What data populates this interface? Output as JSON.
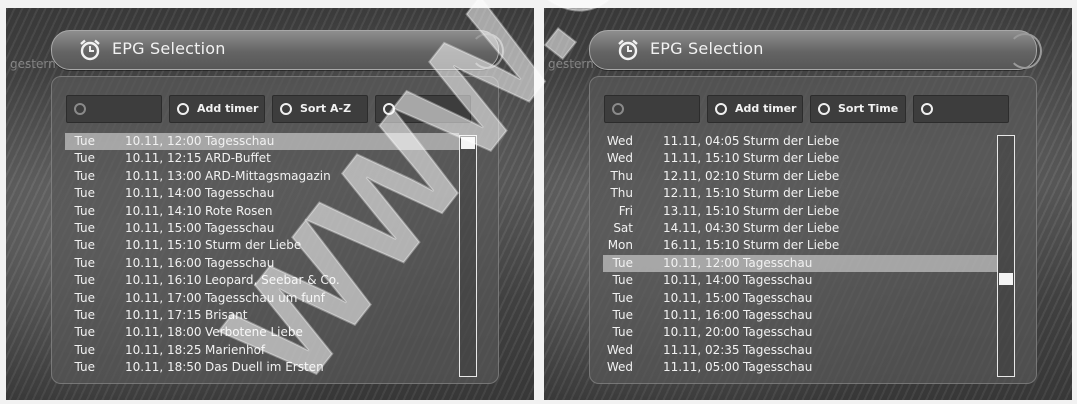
{
  "left": {
    "title": "EPG Selection",
    "ghost_text": "gestern",
    "buttons": [
      {
        "label": "",
        "state": "dim"
      },
      {
        "label": "Add timer",
        "state": "active"
      },
      {
        "label": "Sort A-Z",
        "state": "active"
      },
      {
        "label": "",
        "state": "active"
      }
    ],
    "rows": [
      {
        "day": "Tue",
        "datetime": "10.11, 12:00",
        "title": "Tagesschau"
      },
      {
        "day": "Tue",
        "datetime": "10.11, 12:15",
        "title": "ARD-Buffet"
      },
      {
        "day": "Tue",
        "datetime": "10.11, 13:00",
        "title": "ARD-Mittagsmagazin"
      },
      {
        "day": "Tue",
        "datetime": "10.11, 14:00",
        "title": "Tagesschau"
      },
      {
        "day": "Tue",
        "datetime": "10.11, 14:10",
        "title": "Rote Rosen"
      },
      {
        "day": "Tue",
        "datetime": "10.11, 15:00",
        "title": "Tagesschau"
      },
      {
        "day": "Tue",
        "datetime": "10.11, 15:10",
        "title": "Sturm der Liebe"
      },
      {
        "day": "Tue",
        "datetime": "10.11, 16:00",
        "title": "Tagesschau"
      },
      {
        "day": "Tue",
        "datetime": "10.11, 16:10",
        "title": "Leopard, Seebar & Co."
      },
      {
        "day": "Tue",
        "datetime": "10.11, 17:00",
        "title": "Tagesschau um funf"
      },
      {
        "day": "Tue",
        "datetime": "10.11, 17:15",
        "title": "Brisant"
      },
      {
        "day": "Tue",
        "datetime": "10.11, 18:00",
        "title": "Verbotene Liebe"
      },
      {
        "day": "Tue",
        "datetime": "10.11, 18:25",
        "title": "Marienhof"
      },
      {
        "day": "Tue",
        "datetime": "10.11, 18:50",
        "title": "Das Duell im Ersten"
      }
    ],
    "selected_index": 0,
    "scroll_position": 0.0
  },
  "right": {
    "title": "EPG Selection",
    "ghost_text": "gestern",
    "buttons": [
      {
        "label": "",
        "state": "dim"
      },
      {
        "label": "Add timer",
        "state": "active"
      },
      {
        "label": "Sort Time",
        "state": "active"
      },
      {
        "label": "",
        "state": "active"
      }
    ],
    "rows": [
      {
        "day": "Wed",
        "datetime": "11.11, 04:05",
        "title": "Sturm der Liebe"
      },
      {
        "day": "Wed",
        "datetime": "11.11, 15:10",
        "title": "Sturm der Liebe"
      },
      {
        "day": "Thu",
        "datetime": "12.11, 02:10",
        "title": "Sturm der Liebe"
      },
      {
        "day": "Thu",
        "datetime": "12.11, 15:10",
        "title": "Sturm der Liebe"
      },
      {
        "day": "Fri",
        "datetime": "13.11, 15:10",
        "title": "Sturm der Liebe"
      },
      {
        "day": "Sat",
        "datetime": "14.11, 04:30",
        "title": "Sturm der Liebe"
      },
      {
        "day": "Mon",
        "datetime": "16.11, 15:10",
        "title": "Sturm der Liebe"
      },
      {
        "day": "Tue",
        "datetime": "10.11, 12:00",
        "title": "Tagesschau"
      },
      {
        "day": "Tue",
        "datetime": "10.11, 14:00",
        "title": "Tagesschau"
      },
      {
        "day": "Tue",
        "datetime": "10.11, 15:00",
        "title": "Tagesschau"
      },
      {
        "day": "Tue",
        "datetime": "10.11, 16:00",
        "title": "Tagesschau"
      },
      {
        "day": "Tue",
        "datetime": "10.11, 20:00",
        "title": "Tagesschau"
      },
      {
        "day": "Wed",
        "datetime": "11.11, 02:35",
        "title": "Tagesschau"
      },
      {
        "day": "Wed",
        "datetime": "11.11, 05:00",
        "title": "Tagesschau"
      }
    ],
    "selected_index": 7,
    "scroll_position": 0.6
  },
  "watermark": "WWW.O",
  "colors": {
    "selection": "#c8c8c8",
    "button_bg": "#3d3d3d",
    "text": "#f2f2f2"
  },
  "icons": {
    "title": "alarm-clock-icon",
    "button": "ring-icon"
  }
}
